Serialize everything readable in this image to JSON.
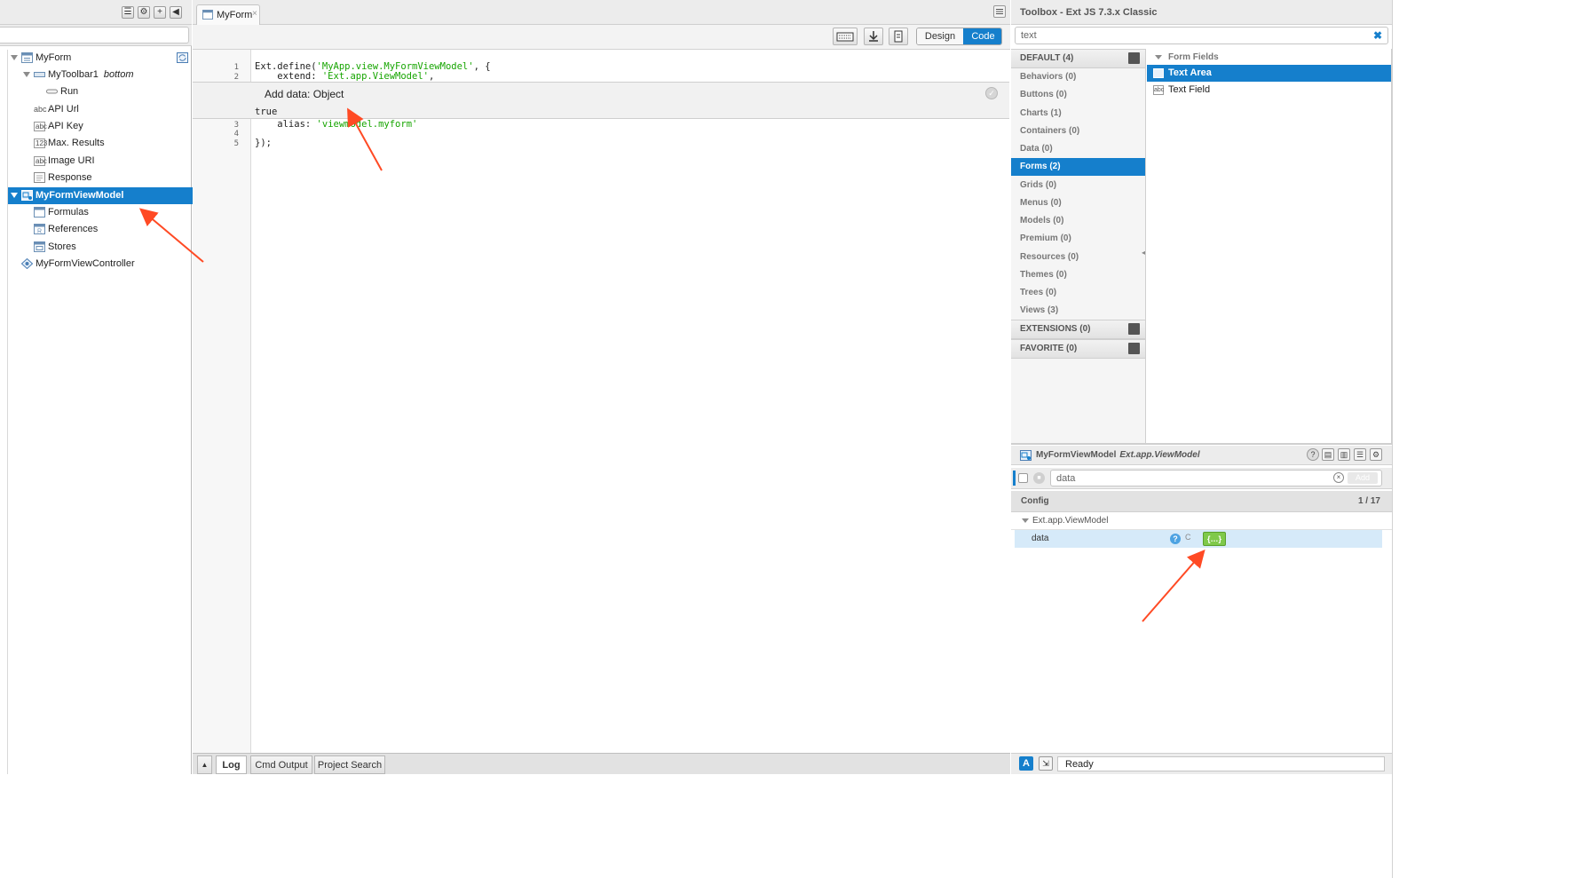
{
  "left": {
    "tree": [
      {
        "label": "MyForm",
        "extra": ""
      },
      {
        "label": "MyToolbar1",
        "extra": "bottom"
      },
      {
        "label": "Run",
        "extra": ""
      },
      {
        "label": "API Url",
        "extra": ""
      },
      {
        "label": "API Key",
        "extra": ""
      },
      {
        "label": "Max. Results",
        "extra": ""
      },
      {
        "label": "Image URI",
        "extra": ""
      },
      {
        "label": "Response",
        "extra": ""
      },
      {
        "label": "MyFormViewModel",
        "extra": ""
      },
      {
        "label": "Formulas",
        "extra": ""
      },
      {
        "label": "References",
        "extra": ""
      },
      {
        "label": "Stores",
        "extra": ""
      },
      {
        "label": "MyFormViewController",
        "extra": ""
      }
    ],
    "icon_texts": {
      "abc": "abc",
      "num": "123"
    }
  },
  "center": {
    "tab_label": "MyForm",
    "tab_close": "×",
    "design_label": "Design",
    "code_label": "Code",
    "lines": {
      "l1": "Ext.define(",
      "l1_str": "'MyApp.view.MyFormViewModel'",
      "l1_end": ", {",
      "l2": "    extend: ",
      "l2_str": "'Ext.app.ViewModel'",
      "l2_end": ",",
      "l3": "    alias: ",
      "l3_str": "'viewmodel.myform'",
      "l5": "});"
    },
    "line_numbers": [
      "1",
      "2",
      "3",
      "4",
      "5"
    ],
    "inline_title": "Add data: Object",
    "inline_value": "true",
    "inline_check": "✓",
    "bottom_tabs": {
      "log": "Log",
      "cmd": "Cmd Output",
      "search": "Project Search"
    }
  },
  "toolbox": {
    "title": "Toolbox - Ext JS 7.3.x Classic",
    "search_value": "text",
    "clear": "✖",
    "default_head": "DEFAULT (4)",
    "categories": [
      "Behaviors (0)",
      "Buttons (0)",
      "Charts (1)",
      "Containers (0)",
      "Data (0)",
      "Forms (2)",
      "Grids (0)",
      "Menus (0)",
      "Models (0)",
      "Premium (0)",
      "Resources (0)",
      "Themes (0)",
      "Trees (0)",
      "Views (3)"
    ],
    "extensions_head": "EXTENSIONS (0)",
    "favorite_head": "FAVORITE (0)",
    "fields_head": "Form Fields",
    "fields": [
      "Text Area",
      "Text Field"
    ]
  },
  "inspector": {
    "title": "MyFormViewModel",
    "subtitle": "Ext.app.ViewModel",
    "search_value": "data",
    "add_label": "Add",
    "config_label": "Config",
    "config_count": "1 / 17",
    "class_label": "Ext.app.ViewModel",
    "prop_name": "data",
    "prop_c": "C",
    "prop_value": "{…}"
  },
  "status": {
    "a_label": "A",
    "text": "Ready"
  },
  "colors": {
    "accent": "#157fcc",
    "arrow": "#ff4a24",
    "string": "#16a500",
    "object_button": "#7fc94b"
  }
}
